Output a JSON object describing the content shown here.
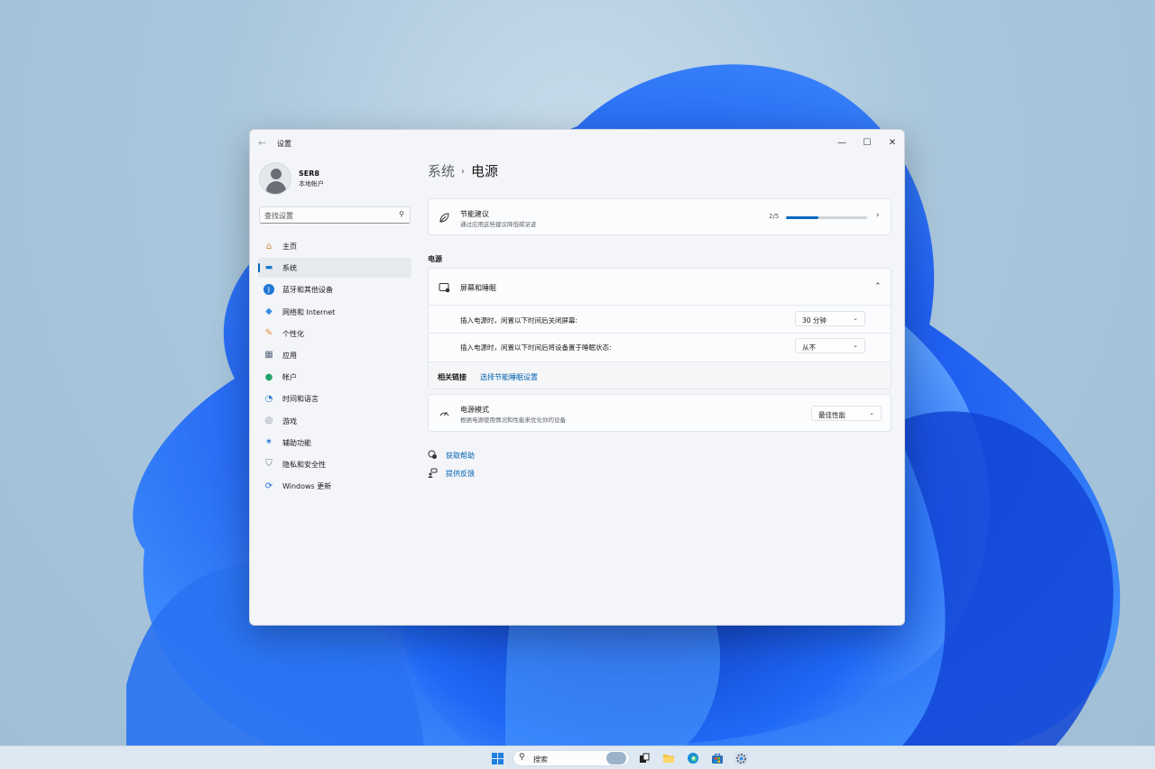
{
  "window": {
    "app_title": "设置",
    "back_glyph": "←",
    "minimize_glyph": "—",
    "maximize_glyph": "☐",
    "close_glyph": "✕"
  },
  "profile": {
    "name": "SER8",
    "account_type": "本地帐户"
  },
  "search": {
    "placeholder": "查找设置",
    "icon_glyph": "⚲"
  },
  "sidebar": {
    "items": [
      {
        "label": "主页",
        "icon": "home-icon",
        "glyph": "⌂",
        "color": "#d08a3a"
      },
      {
        "label": "系统",
        "icon": "system-icon",
        "glyph": "▬",
        "color": "#1a7ad3"
      },
      {
        "label": "蓝牙和其他设备",
        "icon": "bluetooth-icon",
        "glyph": "ᛒ",
        "color": "#ffffff"
      },
      {
        "label": "网络和 Internet",
        "icon": "wifi-icon",
        "glyph": "◆",
        "color": "#3a8ee6"
      },
      {
        "label": "个性化",
        "icon": "brush-icon",
        "glyph": "✎",
        "color": "#e08a2a"
      },
      {
        "label": "应用",
        "icon": "apps-icon",
        "glyph": "▦",
        "color": "#5a6a80"
      },
      {
        "label": "帐户",
        "icon": "account-icon",
        "glyph": "●",
        "color": "#23a36b"
      },
      {
        "label": "时间和语言",
        "icon": "globe-clock-icon",
        "glyph": "◔",
        "color": "#2b7bd0"
      },
      {
        "label": "游戏",
        "icon": "gamepad-icon",
        "glyph": "◎",
        "color": "#7c8590"
      },
      {
        "label": "辅助功能",
        "icon": "accessibility-icon",
        "glyph": "✶",
        "color": "#1f6fd1"
      },
      {
        "label": "隐私和安全性",
        "icon": "shield-icon",
        "glyph": "⛉",
        "color": "#6b7280"
      },
      {
        "label": "Windows 更新",
        "icon": "update-icon",
        "glyph": "⟳",
        "color": "#1f76d6"
      }
    ],
    "active_index": 1
  },
  "breadcrumb": {
    "parent": "系统",
    "separator": "›",
    "current": "电源"
  },
  "energy_card": {
    "title": "节能建议",
    "subtitle": "通过应用这些建议降低碳足迹",
    "progress_text": "2/5",
    "progress_fraction": 0.4,
    "chevron": "›"
  },
  "power_section": {
    "label": "电源",
    "screen_sleep": {
      "title": "屏幕和睡眠",
      "chevron": "⌃",
      "rows": [
        {
          "label": "插入电源时，闲置以下时间后关闭屏幕:",
          "value": "30 分钟"
        },
        {
          "label": "插入电源时，闲置以下时间后将设备置于睡眠状态:",
          "value": "从不"
        }
      ],
      "dropdown_chevron": "⌄",
      "related_label": "相关链接",
      "related_link": "选择节能睡眠设置"
    },
    "power_mode": {
      "title": "电源模式",
      "subtitle": "根据电源使用情况和性能来优化你的设备",
      "value": "最佳性能"
    }
  },
  "help": {
    "get_help": "获取帮助",
    "feedback": "提供反馈"
  },
  "taskbar": {
    "search_text": "搜索",
    "apps": [
      "task-view-icon",
      "file-explorer-icon",
      "edge-icon",
      "store-icon",
      "settings-icon"
    ]
  },
  "colors": {
    "accent": "#0067c0",
    "link": "#0063b1"
  }
}
